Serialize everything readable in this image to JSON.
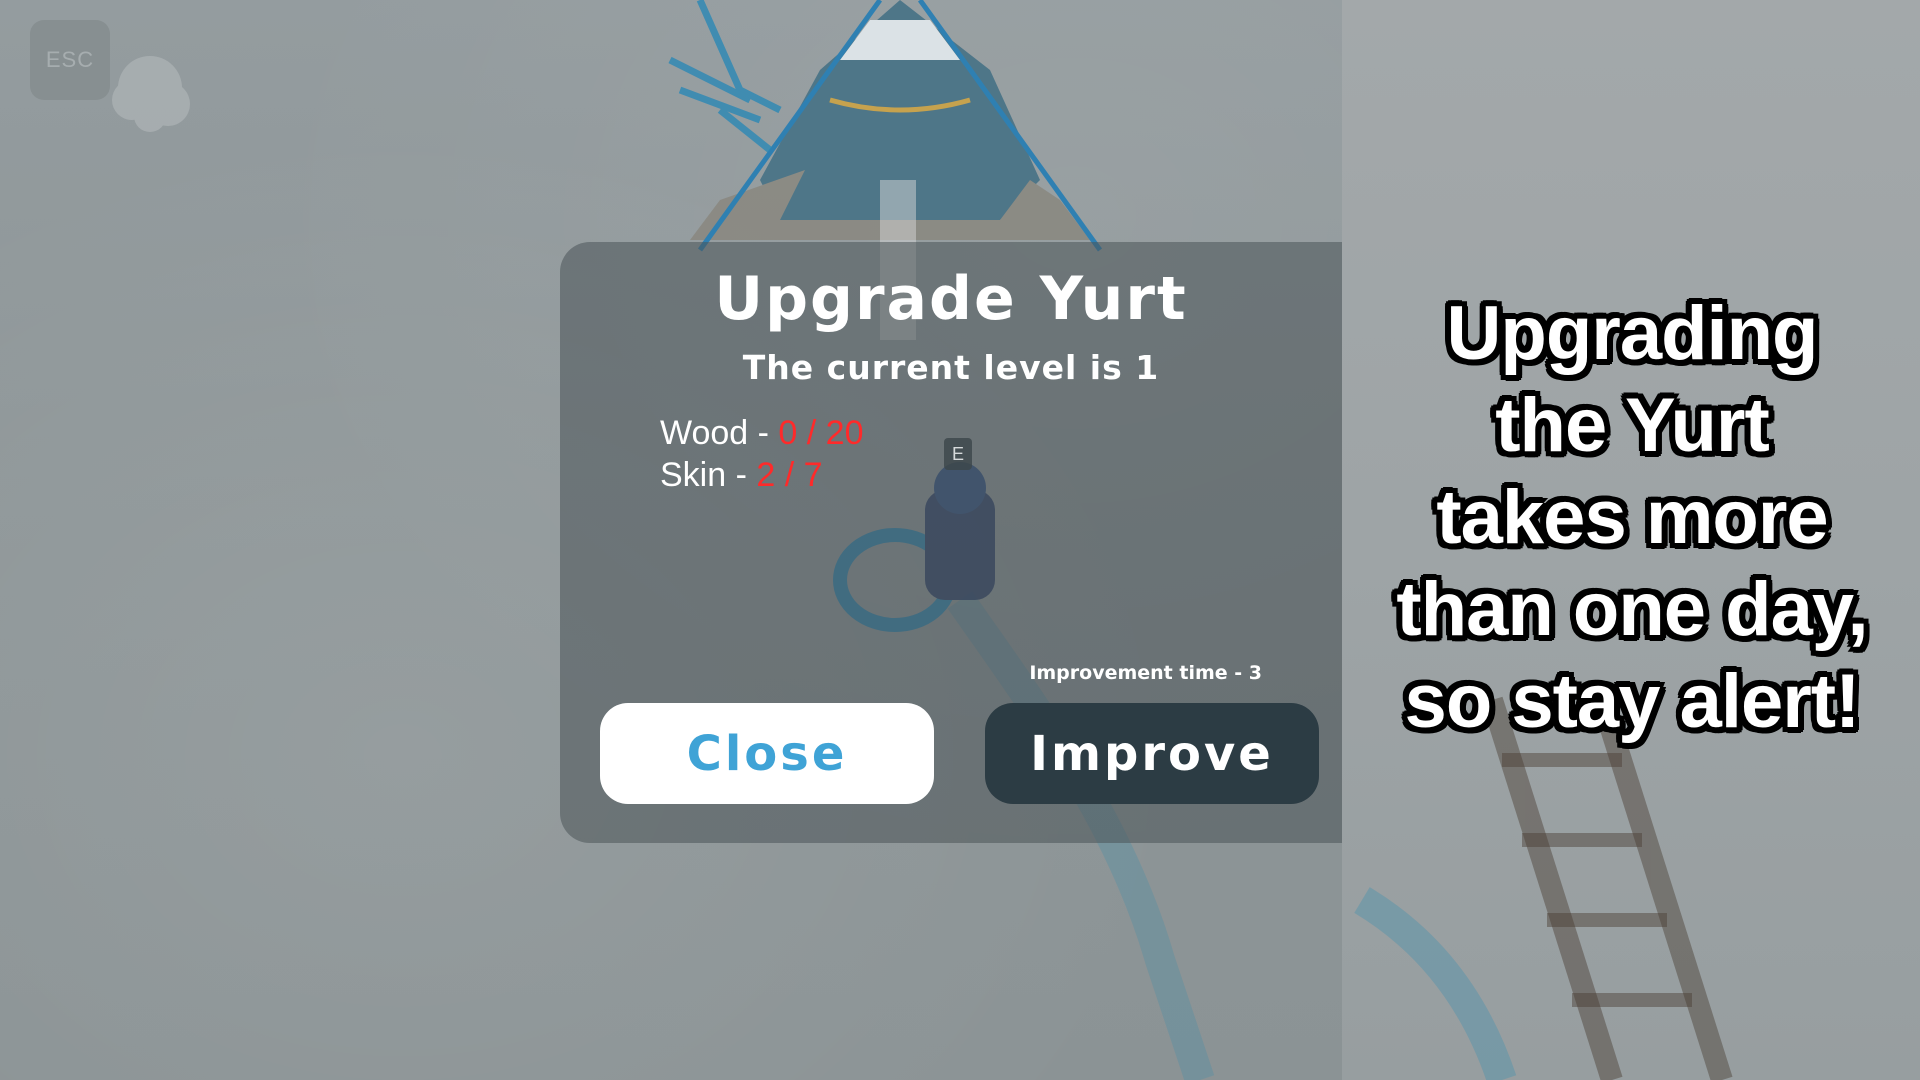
{
  "hud": {
    "esc_label": "ESC",
    "esc_icon": "esc-key-icon",
    "weather_icon": "cloud-icon"
  },
  "dialog": {
    "title": "Upgrade Yurt",
    "subtitle": "The current level is 1",
    "requirements": [
      {
        "label": "Wood - ",
        "value": "0 / 20"
      },
      {
        "label": "Skin - ",
        "value": "2 / 7"
      }
    ],
    "interact_key": "E",
    "improvement_time": "Improvement time - 3",
    "close_label": "Close",
    "improve_label": "Improve"
  },
  "caption": {
    "lines": [
      "Upgrading",
      "the Yurt",
      "takes more",
      "than one day,",
      "so stay alert!"
    ]
  },
  "colors": {
    "missing_resource": "#ff2a2a",
    "close_text": "#3fa3d6",
    "improve_bg": "#2c3c44",
    "snow": "#8f9799"
  }
}
